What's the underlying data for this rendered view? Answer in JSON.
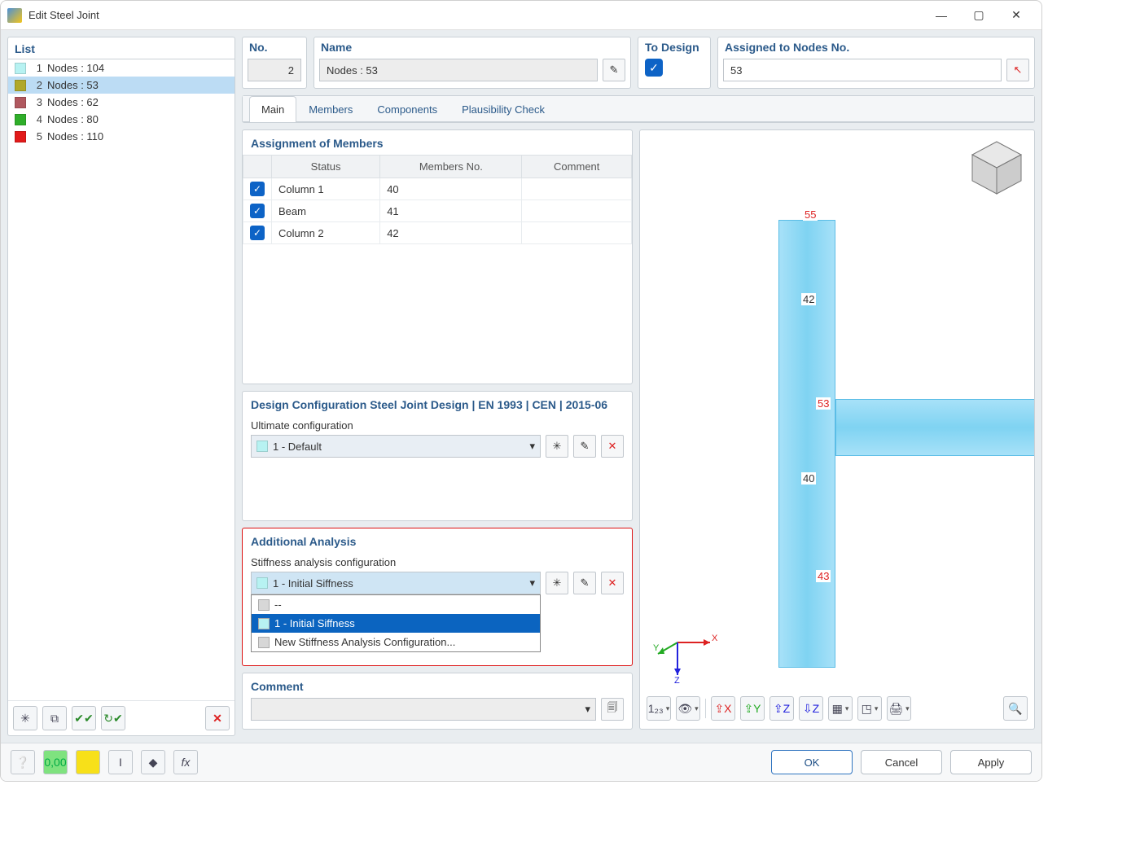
{
  "window": {
    "title": "Edit Steel Joint"
  },
  "list": {
    "title": "List",
    "items": [
      {
        "idx": "1",
        "label": "Nodes : 104",
        "color": "#b7f2f2"
      },
      {
        "idx": "2",
        "label": "Nodes : 53",
        "color": "#b0a82a",
        "selected": true
      },
      {
        "idx": "3",
        "label": "Nodes : 62",
        "color": "#b0585f"
      },
      {
        "idx": "4",
        "label": "Nodes : 80",
        "color": "#2fae2a"
      },
      {
        "idx": "5",
        "label": "Nodes : 110",
        "color": "#e21a1a"
      }
    ]
  },
  "header_fields": {
    "no_label": "No.",
    "no_value": "2",
    "name_label": "Name",
    "name_value": "Nodes : 53",
    "to_design_label": "To Design",
    "to_design_checked": true,
    "assigned_label": "Assigned to Nodes No.",
    "assigned_value": "53"
  },
  "tabs": {
    "items": [
      "Main",
      "Members",
      "Components",
      "Plausibility Check"
    ],
    "active": 0
  },
  "assignment": {
    "title": "Assignment of Members",
    "cols": {
      "status": "Status",
      "members_no": "Members No.",
      "comment": "Comment"
    },
    "rows": [
      {
        "checked": true,
        "status": "Column 1",
        "members": "40",
        "comment": ""
      },
      {
        "checked": true,
        "status": "Beam",
        "members": "41",
        "comment": ""
      },
      {
        "checked": true,
        "status": "Column 2",
        "members": "42",
        "comment": ""
      }
    ]
  },
  "design_config": {
    "title": "Design Configuration Steel Joint Design | EN 1993 | CEN | 2015-06",
    "ultimate_label": "Ultimate configuration",
    "ultimate_value": "1 - Default",
    "ultimate_swatch": "#b7f2f2"
  },
  "additional_analysis": {
    "title": "Additional Analysis",
    "stiffness_label": "Stiffness analysis configuration",
    "stiffness_value": "1 - Initial Siffness",
    "stiffness_swatch": "#b7f2f2",
    "dropdown_items": [
      {
        "label": "--",
        "swatch": "#d7d7d7"
      },
      {
        "label": "1 - Initial Siffness",
        "swatch": "#b7f2f2",
        "highlight": true
      },
      {
        "label": "New Stiffness Analysis Configuration...",
        "swatch": "#d7d7d7"
      }
    ]
  },
  "comment": {
    "title": "Comment"
  },
  "viewport": {
    "node_labels": {
      "top": "55",
      "mid": "53",
      "bottom": "43"
    },
    "member_labels": {
      "upper": "42",
      "lower": "40"
    },
    "axes": {
      "x": "X",
      "y": "Y",
      "z": "Z"
    }
  },
  "buttons": {
    "ok": "OK",
    "cancel": "Cancel",
    "apply": "Apply"
  }
}
